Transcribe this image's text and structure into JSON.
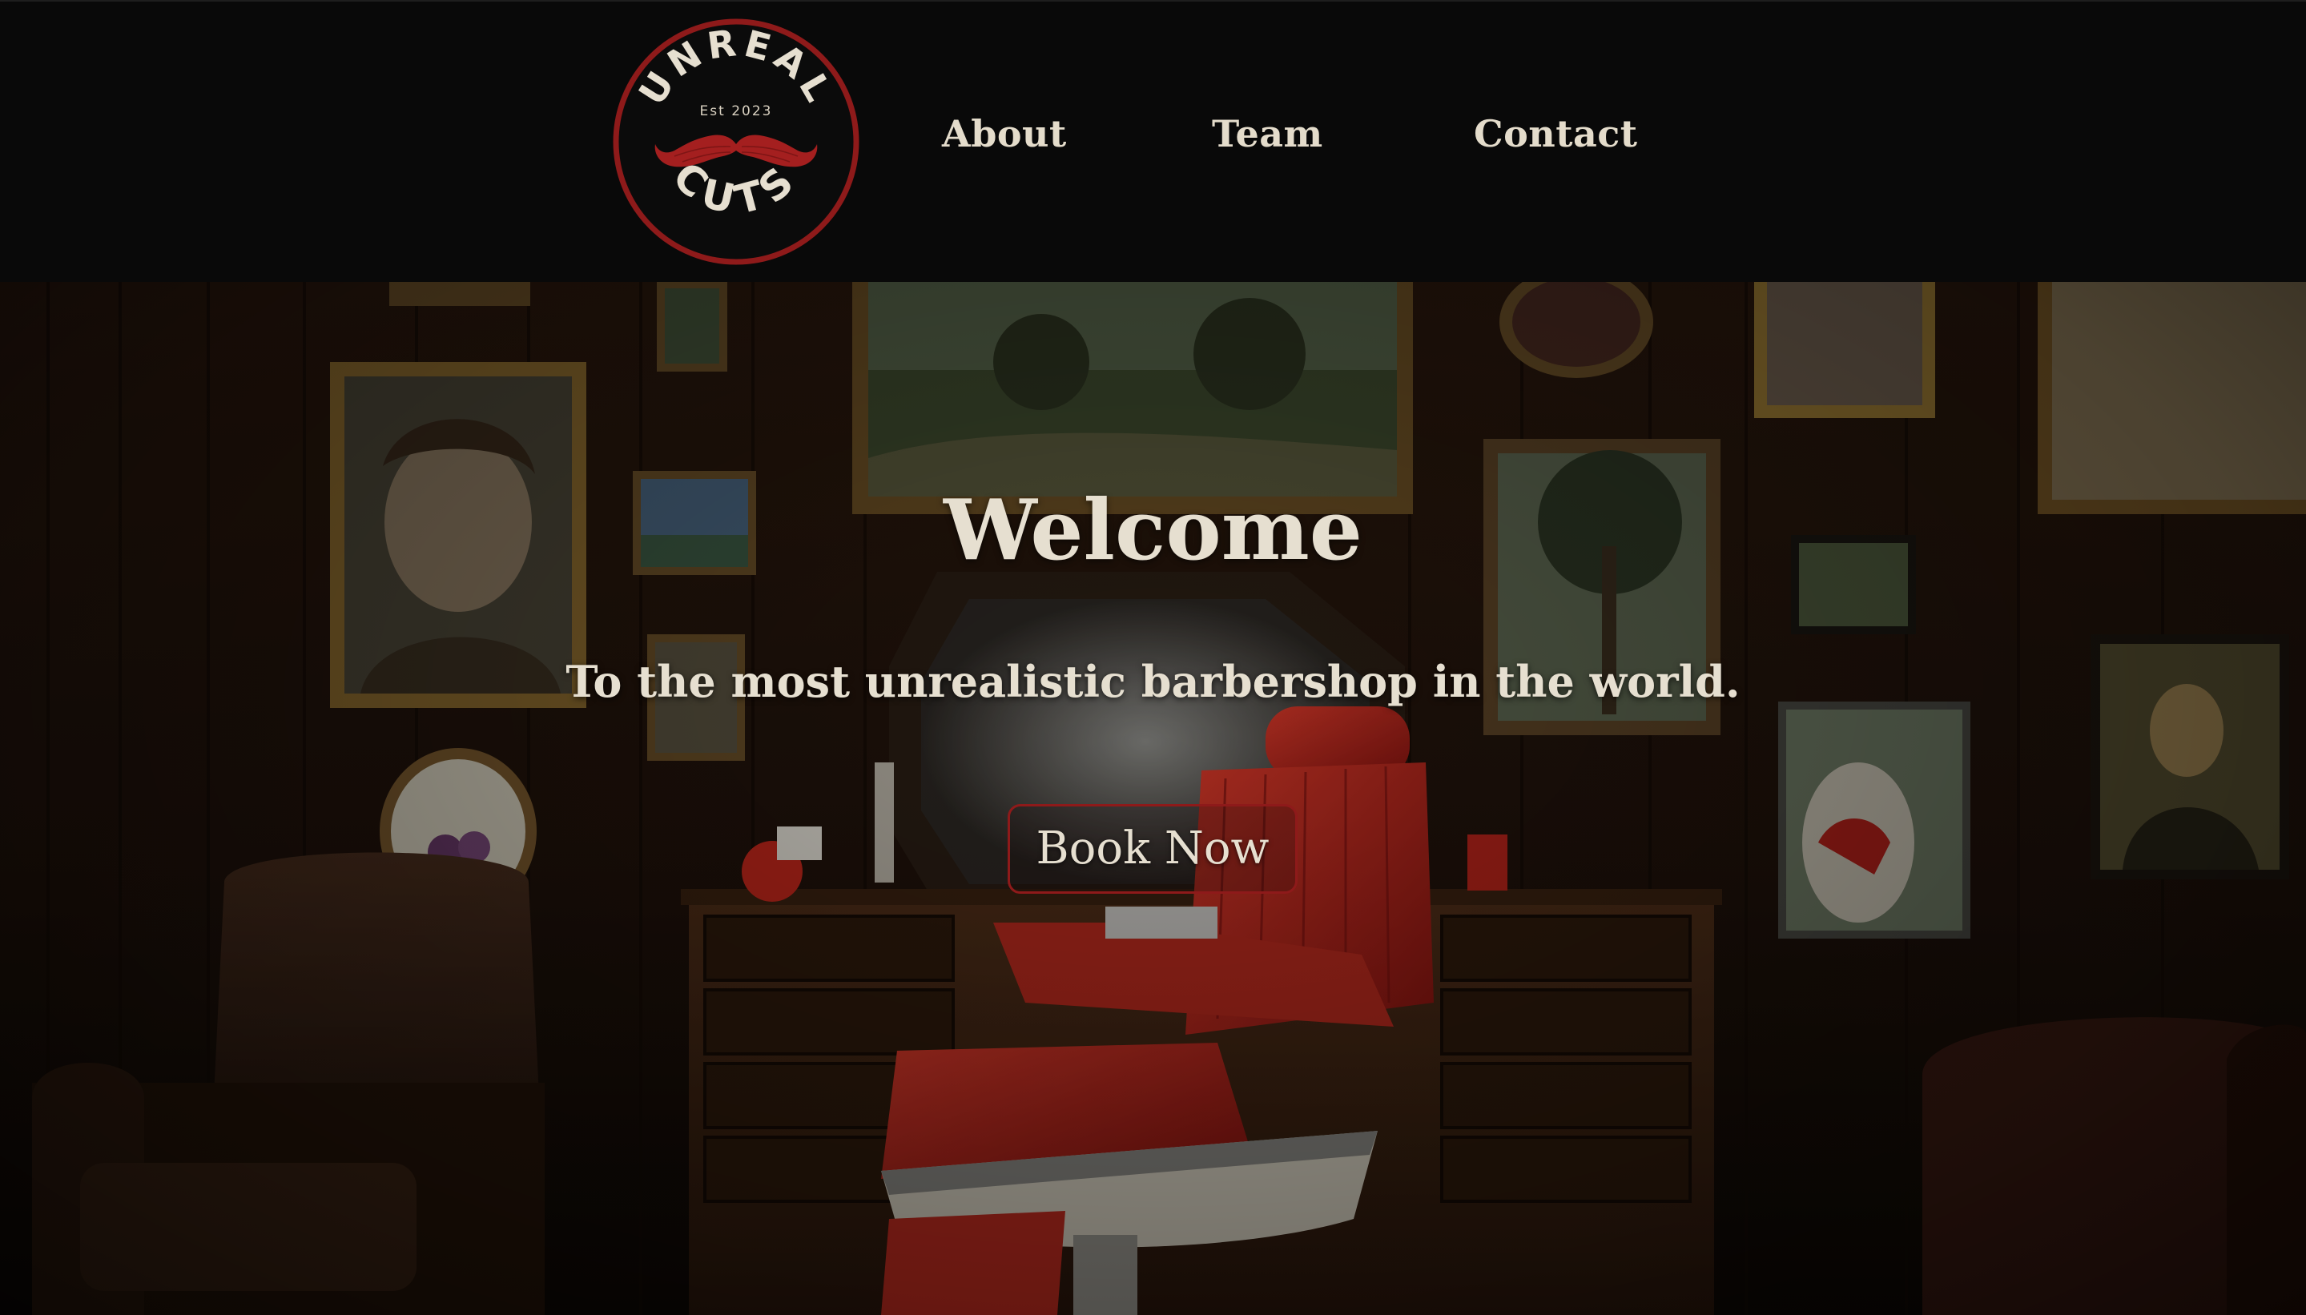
{
  "header": {
    "logo": {
      "top_text": "UNREAL",
      "est_text": "Est 2023",
      "bottom_text": "CUTS",
      "icon": "mustache-icon",
      "ring_color": "#8e1a1a"
    },
    "nav": [
      {
        "label": "About"
      },
      {
        "label": "Team"
      },
      {
        "label": "Contact"
      }
    ]
  },
  "hero": {
    "title": "Welcome",
    "subtitle": "To the most unrealistic barbershop in the world.",
    "cta_label": "Book Now",
    "cta_border_color": "#8e1a1a",
    "background": "barbershop-interior-photo"
  },
  "colors": {
    "header_bg": "#090909",
    "text": "#e6dfd0",
    "accent": "#8e1a1a"
  }
}
